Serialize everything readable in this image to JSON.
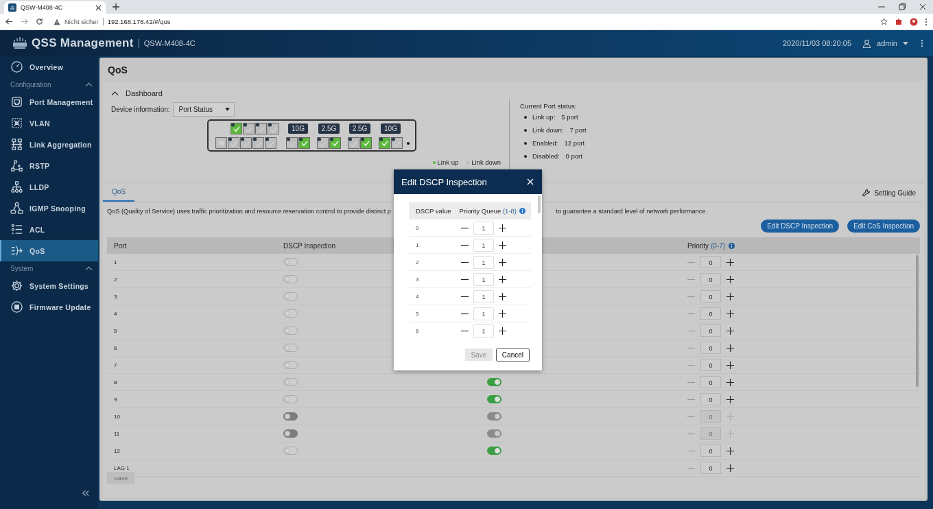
{
  "browser": {
    "tab_title": "QSW-M408-4C",
    "security": "Nicht sicher",
    "url": "192.168.178.42/#/qos"
  },
  "header": {
    "title": "QSS Management",
    "device": "QSW-M408-4C",
    "datetime": "2020/11/03 08:20:05",
    "user": "admin"
  },
  "sidebar": {
    "items": [
      {
        "kind": "item",
        "label": "Overview",
        "selected": false
      },
      {
        "kind": "section",
        "label": "Configuration",
        "expanded": true
      },
      {
        "kind": "item",
        "label": "Port Management",
        "selected": false
      },
      {
        "kind": "item",
        "label": "VLAN",
        "selected": false
      },
      {
        "kind": "item",
        "label": "Link Aggregation",
        "selected": false
      },
      {
        "kind": "item",
        "label": "RSTP",
        "selected": false
      },
      {
        "kind": "item",
        "label": "LLDP",
        "selected": false
      },
      {
        "kind": "item",
        "label": "IGMP Snooping",
        "selected": false
      },
      {
        "kind": "item",
        "label": "ACL",
        "selected": false
      },
      {
        "kind": "item",
        "label": "QoS",
        "selected": true
      },
      {
        "kind": "section",
        "label": "System",
        "expanded": true
      },
      {
        "kind": "item",
        "label": "System Settings",
        "selected": false
      },
      {
        "kind": "item",
        "label": "Firmware Update",
        "selected": false
      }
    ]
  },
  "page": {
    "title": "QoS"
  },
  "dashboard": {
    "label": "Dashboard",
    "expanded": true,
    "device_info_label": "Device information:",
    "device_info_value": "Port Status",
    "ports_top": [
      {
        "link_up": true
      },
      {
        "link_up": false
      },
      {
        "link_up": false
      },
      {
        "link_up": false
      }
    ],
    "ports_bottom": [
      {
        "link_up": false
      },
      {
        "link_up": false
      },
      {
        "link_up": false
      },
      {
        "link_up": false
      }
    ],
    "groups": [
      {
        "speed": "10G",
        "ports": [
          {
            "link_up": false
          },
          {
            "link_up": true
          }
        ]
      },
      {
        "speed": "2.5G",
        "ports": [
          {
            "link_up": false
          },
          {
            "link_up": true
          }
        ]
      },
      {
        "speed": "2.5G",
        "ports": [
          {
            "link_up": false
          },
          {
            "link_up": true
          }
        ]
      },
      {
        "speed": "10G",
        "ports": [
          {
            "link_up": true
          },
          {
            "link_up": false
          }
        ]
      }
    ],
    "legend": [
      {
        "label": "Link up",
        "color": "#5cb83c"
      },
      {
        "label": "Link down",
        "color": "#b5b5b5"
      }
    ],
    "status_title": "Current Port status:",
    "status": [
      {
        "label": "Link up:",
        "value": "5 port"
      },
      {
        "label": "Link down:",
        "value": "7 port"
      },
      {
        "label": "Enabled:",
        "value": "12 port"
      },
      {
        "label": "Disabled:",
        "value": "0 port"
      }
    ]
  },
  "tabs": [
    {
      "label": "QoS",
      "selected": true
    }
  ],
  "setting_guide": "Setting Guide",
  "description": "QoS (Quality of Service) uses traffic prioritization and resource reservation control to provide distinct p",
  "description_end": "to guarantee a standard level of network performance.",
  "buttons": [
    "Edit DSCP Inspection",
    "Edit CoS Inspection"
  ],
  "table": {
    "columns": {
      "port": "Port",
      "dscp": "DSCP Inspection",
      "priority": "Priority",
      "priority_range": "(0-7)"
    },
    "rows": [
      {
        "port": "1",
        "dscp": {
          "on": false,
          "disabled": false
        },
        "priority": "0",
        "priority_disabled": false
      },
      {
        "port": "2",
        "dscp": {
          "on": false,
          "disabled": false
        },
        "priority": "0",
        "priority_disabled": false
      },
      {
        "port": "3",
        "dscp": {
          "on": false,
          "disabled": false
        },
        "priority": "0",
        "priority_disabled": false
      },
      {
        "port": "4",
        "dscp": {
          "on": false,
          "disabled": false
        },
        "priority": "0",
        "priority_disabled": false
      },
      {
        "port": "5",
        "dscp": {
          "on": false,
          "disabled": false
        },
        "priority": "0",
        "priority_disabled": false
      },
      {
        "port": "6",
        "dscp": {
          "on": false,
          "disabled": false
        },
        "priority": "0",
        "priority_disabled": false
      },
      {
        "port": "7",
        "dscp": {
          "on": false,
          "disabled": false
        },
        "priority": "0",
        "priority_disabled": false
      },
      {
        "port": "8",
        "dscp": {
          "on": false,
          "disabled": false
        },
        "cos": {
          "on": true,
          "disabled": false
        },
        "priority": "0",
        "priority_disabled": false
      },
      {
        "port": "9",
        "dscp": {
          "on": false,
          "disabled": false
        },
        "cos": {
          "on": true,
          "disabled": false
        },
        "priority": "0",
        "priority_disabled": false
      },
      {
        "port": "10",
        "dscp": {
          "on": false,
          "disabled": true
        },
        "cos": {
          "on": true,
          "disabled": true
        },
        "priority": "0",
        "priority_disabled": true
      },
      {
        "port": "11",
        "dscp": {
          "on": false,
          "disabled": true
        },
        "cos": {
          "on": true,
          "disabled": true
        },
        "priority": "0",
        "priority_disabled": true
      },
      {
        "port": "12",
        "dscp": {
          "on": false,
          "disabled": false
        },
        "cos": {
          "on": true,
          "disabled": false
        },
        "priority": "0",
        "priority_disabled": false
      },
      {
        "port": "LAG 1",
        "priority": "0",
        "priority_disabled": false
      }
    ]
  },
  "save_button": {
    "label": "Save",
    "disabled": true
  },
  "modal": {
    "title": "Edit DSCP Inspection",
    "col_value": "DSCP value",
    "col_queue": "Priority Queue",
    "col_range": "(1-8)",
    "rows": [
      {
        "value": "0",
        "queue": "1"
      },
      {
        "value": "1",
        "queue": "1"
      },
      {
        "value": "2",
        "queue": "1"
      },
      {
        "value": "3",
        "queue": "1"
      },
      {
        "value": "4",
        "queue": "1"
      },
      {
        "value": "5",
        "queue": "1"
      },
      {
        "value": "6",
        "queue": "1"
      }
    ],
    "save": {
      "label": "Save",
      "disabled": true
    },
    "cancel": "Cancel"
  }
}
